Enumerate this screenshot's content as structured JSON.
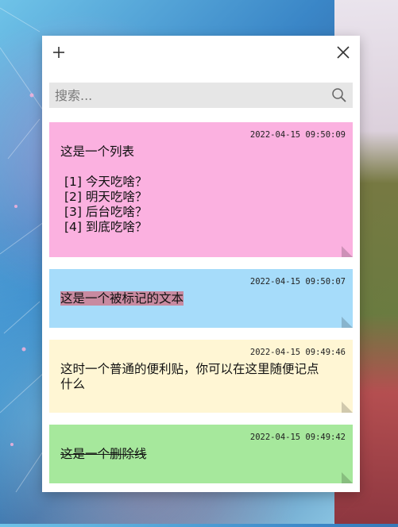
{
  "toolbar": {
    "add_icon": "plus-icon",
    "close_icon": "close-icon"
  },
  "search": {
    "placeholder": "搜索...",
    "value": "",
    "icon": "search-icon"
  },
  "notes": [
    {
      "timestamp": "2022-04-15 09:50:09",
      "color": "#fbb1e0",
      "text": "这是一个列表\n\n [1] 今天吃啥？\n [2] 明天吃啥？\n [3] 后台吃啥？\n [4] 到底吃啥？"
    },
    {
      "timestamp": "2022-04-15 09:50:07",
      "color": "#a6dcfa",
      "text": "这是一个被标记的文本",
      "style": "highlight",
      "highlight_color": "#c88aa0"
    },
    {
      "timestamp": "2022-04-15 09:49:46",
      "color": "#fff6d4",
      "text": "这时一个普通的便利贴，你可以在这里随便记点什么"
    },
    {
      "timestamp": "2022-04-15 09:49:42",
      "color": "#a6e89c",
      "text": "这是一个删除线",
      "style": "strikethrough"
    }
  ]
}
